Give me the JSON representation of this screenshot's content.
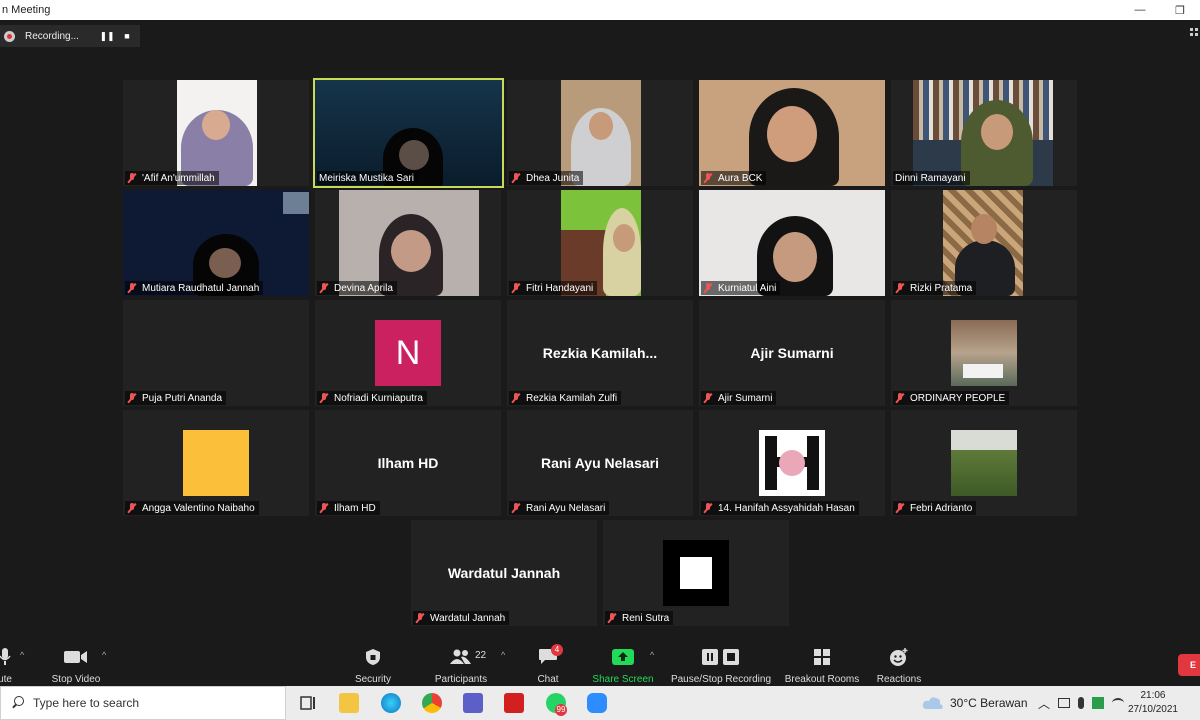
{
  "window": {
    "title": "n Meeting",
    "minimize": "—",
    "restore": "❐"
  },
  "recording": {
    "label": "Recording...",
    "pause": "❚❚",
    "stop": "■"
  },
  "participants_tiles": [
    {
      "name": "'Afif An'ummillah",
      "muted": true
    },
    {
      "name": "Meiriska Mustika Sari",
      "muted": false,
      "active_speaker": true
    },
    {
      "name": "Dhea Junita",
      "muted": true
    },
    {
      "name": "Aura BCK",
      "muted": true
    },
    {
      "name": "Dinni Ramayani",
      "muted": false
    },
    {
      "name": "Mutiara Raudhatul Jannah",
      "muted": true
    },
    {
      "name": "Devina Aprila",
      "muted": true
    },
    {
      "name": "Fitri Handayani",
      "muted": true
    },
    {
      "name": "Kurniatul Aini",
      "muted": true
    },
    {
      "name": "Rizki Pratama",
      "muted": true
    },
    {
      "name": "Puja Putri Ananda",
      "muted": true
    },
    {
      "name": "Nofriadi Kurniaputra",
      "muted": true,
      "avatar_letter": "N"
    },
    {
      "name": "Rezkia Kamilah Zulfi",
      "muted": true,
      "display": "Rezkia  Kamilah..."
    },
    {
      "name": "Ajir Sumarni",
      "muted": true,
      "display": "Ajir Sumarni"
    },
    {
      "name": "ORDINARY PEOPLE",
      "muted": true
    },
    {
      "name": "Angga Valentino Naibaho",
      "muted": true
    },
    {
      "name": "Ilham HD",
      "muted": true,
      "display": "Ilham HD"
    },
    {
      "name": "Rani Ayu Nelasari",
      "muted": true,
      "display": "Rani Ayu Nelasari"
    },
    {
      "name": "14. Hanifah Assyahidah Hasan",
      "muted": true
    },
    {
      "name": "Febri Adrianto",
      "muted": true
    },
    {
      "name": "Wardatul Jannah",
      "muted": true,
      "display": "Wardatul Jannah"
    },
    {
      "name": "Reni Sutra",
      "muted": true
    }
  ],
  "toolbar": {
    "mute_label": "ute",
    "stop_video_label": "Stop Video",
    "security_label": "Security",
    "participants_label": "Participants",
    "participants_count": "22",
    "chat_label": "Chat",
    "chat_badge": "4",
    "share_screen_label": "Share Screen",
    "pause_stop_recording_label": "Pause/Stop Recording",
    "breakout_rooms_label": "Breakout Rooms",
    "reactions_label": "Reactions",
    "end_label": "E",
    "caret": "^"
  },
  "taskbar": {
    "search_placeholder": "Type here to search",
    "whatsapp_badge": "99",
    "weather": "30°C  Berawan",
    "time": "21:06",
    "date": "27/10/2021"
  },
  "colors": {
    "active_speaker_border": "#c9db55",
    "share_screen_green": "#23d959",
    "muted_red": "#e55555",
    "avatar_n_bg": "#cc2161",
    "end_red": "#e0383e"
  },
  "icons": {
    "mute": "microphone-icon",
    "video": "video-camera-icon",
    "security": "shield-icon",
    "participants": "people-icon",
    "chat": "chat-bubble-icon",
    "share": "share-screen-arrow-icon",
    "recording": "pause-stop-icon",
    "breakout": "grid-squares-icon",
    "reactions": "smiley-plus-icon"
  }
}
